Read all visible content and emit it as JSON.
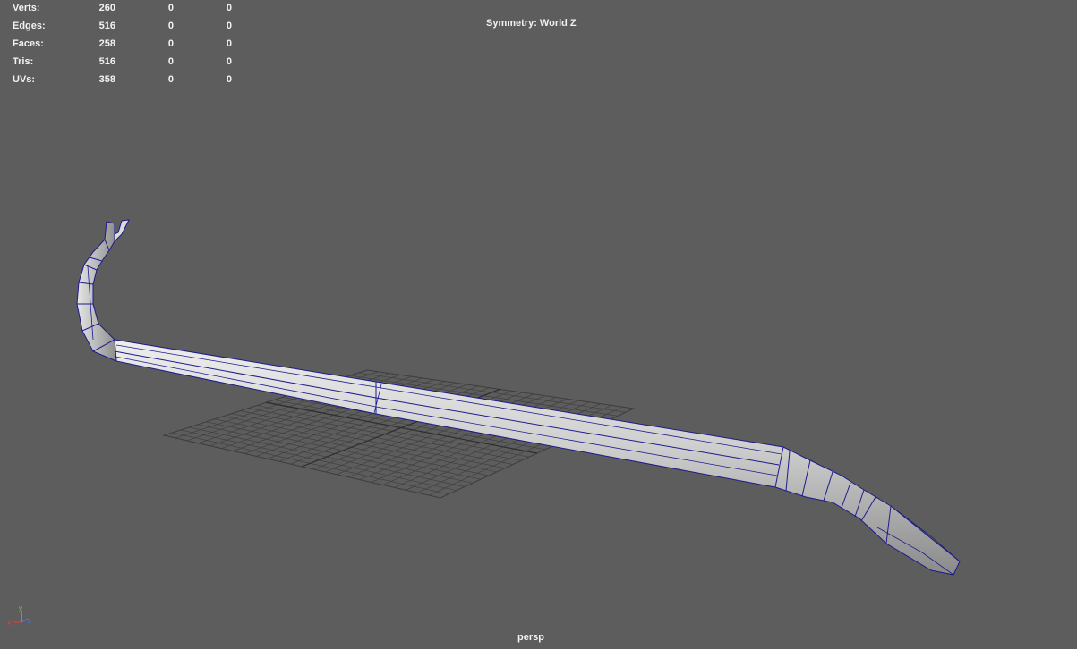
{
  "viewport": {
    "camera_name": "persp",
    "symmetry_text": "Symmetry: World Z"
  },
  "hud": {
    "rows": [
      {
        "label": "Verts:",
        "values": [
          "260",
          "0",
          "0"
        ]
      },
      {
        "label": "Edges:",
        "values": [
          "516",
          "0",
          "0"
        ]
      },
      {
        "label": "Faces:",
        "values": [
          "258",
          "0",
          "0"
        ]
      },
      {
        "label": "Tris:",
        "values": [
          "516",
          "0",
          "0"
        ]
      },
      {
        "label": "UVs:",
        "values": [
          "358",
          "0",
          "0"
        ]
      }
    ]
  },
  "axis_gizmo": {
    "x_label": "x",
    "y_label": "y",
    "z_label": "z",
    "x_color": "#e0403c",
    "y_color": "#6fd24a",
    "z_color": "#4a78e8"
  },
  "scene": {
    "object": "crowbar-mesh",
    "wireframe_color": "#1c1c8c",
    "grid_color": "#3a3a3a",
    "shading_light": "#d4d4d4",
    "shading_dark": "#7a7a7a"
  }
}
